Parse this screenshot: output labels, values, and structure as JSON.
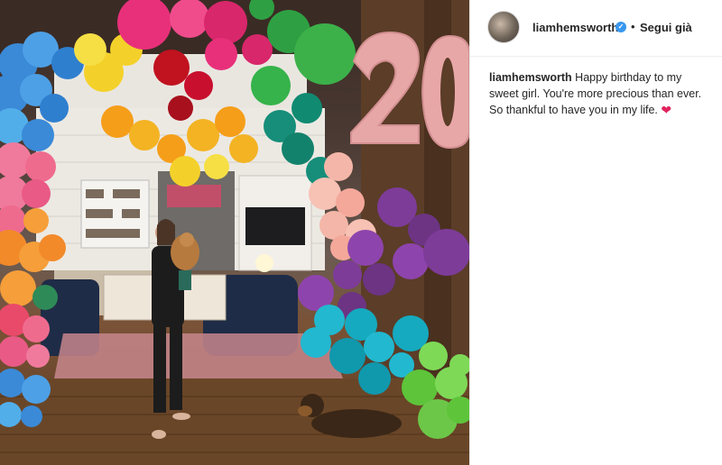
{
  "post": {
    "username": "liamhemsworth",
    "verified_icon": "verified-badge-icon",
    "separator": "•",
    "follow_label": "Segui già",
    "caption_user": "liamhemsworth",
    "caption_text": "Happy birthday to my sweet girl. You're more precious than ever. So thankful to have you in my life.",
    "caption_emoji": "❤"
  },
  "photo": {
    "balloon_numbers": "20",
    "number_color": "#e8a7a7"
  },
  "colors": {
    "accent_blue": "#3897f0",
    "text": "#262626",
    "border": "#efefef",
    "heart": "#e0245e"
  }
}
